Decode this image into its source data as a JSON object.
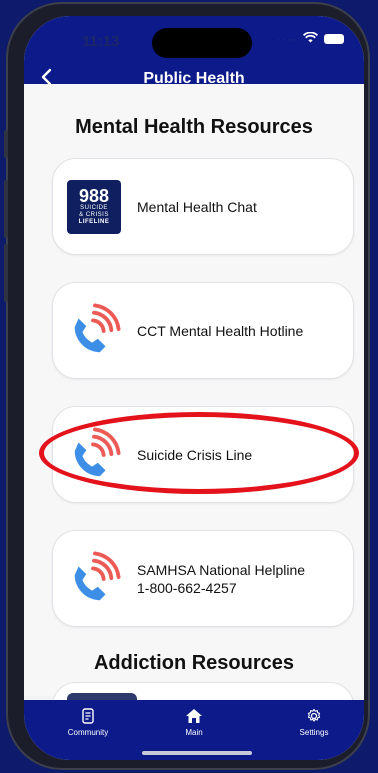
{
  "status": {
    "time": "11:13"
  },
  "header": {
    "title": "Public Health",
    "back_icon": "chevron-left-icon"
  },
  "sections": {
    "mental": {
      "title": "Mental Health Resources"
    },
    "addiction": {
      "title": "Addiction Resources"
    }
  },
  "cards": [
    {
      "lines": [
        "Mental Health Chat"
      ],
      "icon": "lifeline-logo",
      "logo": {
        "number": "988",
        "line1": "SUICIDE",
        "line2": "& CRISIS",
        "line3": "LIFELINE"
      }
    },
    {
      "lines": [
        "CCT Mental Health Hotline"
      ],
      "icon": "phone-icon"
    },
    {
      "lines": [
        "Suicide Crisis Line"
      ],
      "icon": "phone-icon"
    },
    {
      "lines": [
        "SAMHSA National Helpline",
        "1-800-662-4257"
      ],
      "icon": "phone-icon"
    }
  ],
  "tabs": [
    {
      "label": "Community",
      "icon": "document-icon"
    },
    {
      "label": "Main",
      "icon": "home-icon"
    },
    {
      "label": "Settings",
      "icon": "gear-icon"
    }
  ],
  "colors": {
    "header": "#0d1a8a",
    "highlight": "#e3121b",
    "phone_blue": "#3d8ee6",
    "signal_red": "#ec5b56"
  }
}
